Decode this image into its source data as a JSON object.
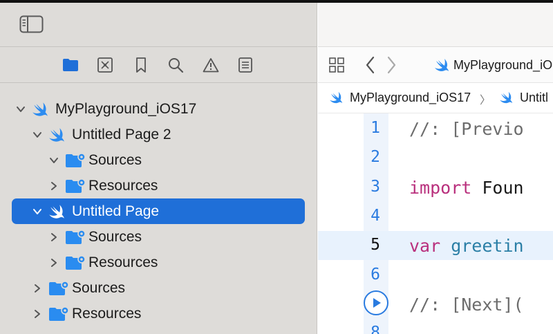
{
  "sidebar": {
    "tabs": [
      {
        "icon": "folder-icon"
      },
      {
        "icon": "source-control-icon"
      },
      {
        "icon": "bookmark-icon"
      },
      {
        "icon": "search-icon"
      },
      {
        "icon": "warning-icon"
      },
      {
        "icon": "list-icon"
      }
    ],
    "tree": [
      {
        "label": "MyPlayground_iOS17",
        "icon": "swift-icon",
        "level": 0,
        "expanded": true
      },
      {
        "label": "Untitled Page 2",
        "icon": "swift-icon",
        "level": 1,
        "expanded": true
      },
      {
        "label": "Sources",
        "icon": "folder-gear-icon",
        "level": 2,
        "expanded": true
      },
      {
        "label": "Resources",
        "icon": "folder-gear-icon",
        "level": 2,
        "expanded": false
      },
      {
        "label": "Untitled Page",
        "icon": "swift-icon",
        "level": 1,
        "expanded": true,
        "selected": true
      },
      {
        "label": "Sources",
        "icon": "folder-gear-icon",
        "level": 2,
        "expanded": false
      },
      {
        "label": "Resources",
        "icon": "folder-gear-icon",
        "level": 2,
        "expanded": false
      },
      {
        "label": "Sources",
        "icon": "folder-gear-icon",
        "level": 1,
        "expanded": false
      },
      {
        "label": "Resources",
        "icon": "folder-gear-icon",
        "level": 1,
        "expanded": false
      }
    ]
  },
  "editor": {
    "tab_title": "MyPlayground_iO",
    "breadcrumb": [
      "MyPlayground_iOS17",
      "Untitl"
    ],
    "breadcrumb_sep": "〉",
    "lines": [
      {
        "num": "1",
        "parts": [
          {
            "t": "//: [Previo",
            "c": "comment"
          }
        ]
      },
      {
        "num": "2",
        "parts": []
      },
      {
        "num": "3",
        "parts": [
          {
            "t": "import",
            "c": "kw"
          },
          {
            "t": " Foun",
            "c": "ident"
          }
        ]
      },
      {
        "num": "4",
        "parts": []
      },
      {
        "num": "5",
        "parts": [
          {
            "t": "var",
            "c": "kw"
          },
          {
            "t": " greetin",
            "c": "ident2"
          }
        ],
        "current": true
      },
      {
        "num": "6",
        "parts": []
      },
      {
        "num": "",
        "parts": [
          {
            "t": "//: [Next](",
            "c": "comment"
          }
        ],
        "run": true
      },
      {
        "num": "8",
        "parts": []
      }
    ]
  },
  "colors": {
    "accent": "#1f6fd8",
    "swift": "#2d8cf0",
    "folder": "#2a8cf0",
    "keyword": "#b9307d"
  }
}
